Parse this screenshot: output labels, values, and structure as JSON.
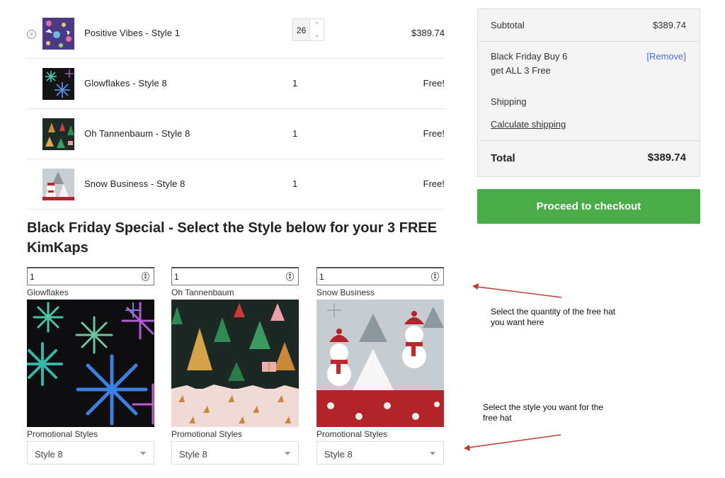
{
  "cart": {
    "items": [
      {
        "name": "Positive Vibes - Style 1",
        "qty": "26",
        "price": "$389.74",
        "thumb_icon": "positive-vibes-pattern"
      },
      {
        "name": "Glowflakes - Style 8",
        "qty": "1",
        "price": "Free!",
        "thumb_icon": "glowflakes-pattern"
      },
      {
        "name": "Oh Tannenbaum - Style 8",
        "qty": "1",
        "price": "Free!",
        "thumb_icon": "tannenbaum-pattern"
      },
      {
        "name": "Snow Business - Style 8",
        "qty": "1",
        "price": "Free!",
        "thumb_icon": "snow-business-pattern"
      }
    ],
    "remove_icon": "×"
  },
  "summary": {
    "subtotal_label": "Subtotal",
    "subtotal_value": "$389.74",
    "discount_line1": "Black Friday Buy 6",
    "discount_line2": "get ALL 3 Free",
    "remove_label": "[Remove]",
    "shipping_label": "Shipping",
    "calculate_shipping": "Calculate shipping",
    "total_label": "Total",
    "total_value": "$389.74",
    "checkout_label": "Proceed to checkout"
  },
  "promo": {
    "heading": "Black Friday Special - Select the Style below for your 3 FREE KimKaps",
    "items": [
      {
        "qty": "1",
        "name": "Glowflakes",
        "style_label": "Promotional Styles",
        "style_value": "Style 8"
      },
      {
        "qty": "1",
        "name": "Oh Tannenbaum",
        "style_label": "Promotional Styles",
        "style_value": "Style 8"
      },
      {
        "qty": "1",
        "name": "Snow Business",
        "style_label": "Promotional Styles",
        "style_value": "Style 8"
      }
    ]
  },
  "annotations": {
    "note1_line1": "Select the quantity of the free hat",
    "note1_line2": "you want here",
    "note2_line1": "Select the style you want for the",
    "note2_line2": "free hat",
    "arrow_color": "#c0392b"
  },
  "colors": {
    "checkout_green": "#4aac49",
    "link_blue": "#4a6fd8",
    "summary_bg": "#f4f4f4"
  }
}
